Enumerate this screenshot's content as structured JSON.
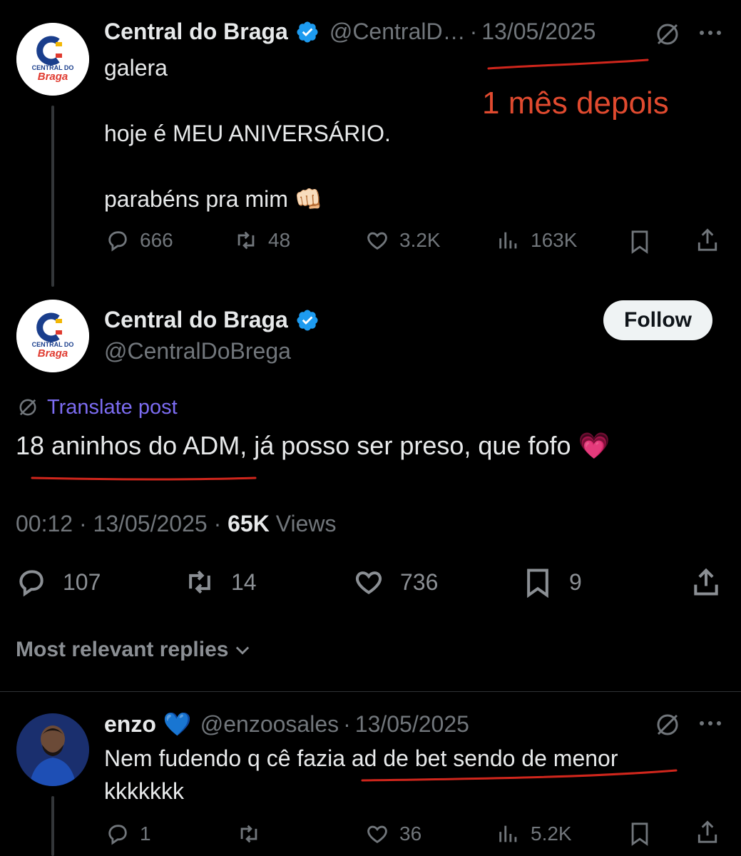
{
  "colors": {
    "background": "#000000",
    "text_primary": "#e7e9ea",
    "text_muted": "#71767b",
    "verified_blue": "#1d9bf0",
    "translate_purple": "#7c6cf2",
    "annotation_red": "#e04a2f",
    "follow_bg": "#eff3f4"
  },
  "quoted_post": {
    "author_name": "Central do Braga",
    "handle": "@CentralD…",
    "separator": "·",
    "date": "13/05/2025",
    "avatar_text_top": "CENTRAL DO",
    "avatar_text_bottom": "Braga",
    "body": "galera\n\nhoje é MEU ANIVERSÁRIO.\n\nparabéns pra mim 👊🏻",
    "stats": {
      "replies": "666",
      "reposts": "48",
      "likes": "3.2K",
      "views": "163K"
    }
  },
  "annotation": {
    "text": "1 mês depois"
  },
  "main_post": {
    "author_name": "Central do Braga",
    "handle": "@CentralDoBrega",
    "follow_label": "Follow",
    "translate_label": "Translate post",
    "body": "18 aninhos do ADM, já posso ser preso, que fofo 💗",
    "time": "00:12",
    "date": "13/05/2025",
    "views_count": "65K",
    "views_label": "Views",
    "stats": {
      "replies": "107",
      "reposts": "14",
      "likes": "736",
      "bookmarks": "9"
    }
  },
  "replies_filter": {
    "label": "Most relevant replies"
  },
  "reply": {
    "author_name": "enzo",
    "author_emoji": "💙",
    "handle": "@enzoosales",
    "date": "13/05/2025",
    "body": "Nem fudendo q cê fazia ad de bet sendo de menor\nkkkkkkk",
    "stats": {
      "replies": "1",
      "reposts": "",
      "likes": "36",
      "views": "5.2K"
    }
  },
  "icons": {
    "verified": "verified-badge-icon",
    "translate": "translate-globe-icon",
    "more": "more-dots-icon",
    "reply": "reply-bubble-icon",
    "repost": "repost-icon",
    "like": "heart-icon",
    "views": "views-bars-icon",
    "bookmark": "bookmark-icon",
    "share": "share-icon",
    "chevron": "chevron-down-icon"
  }
}
